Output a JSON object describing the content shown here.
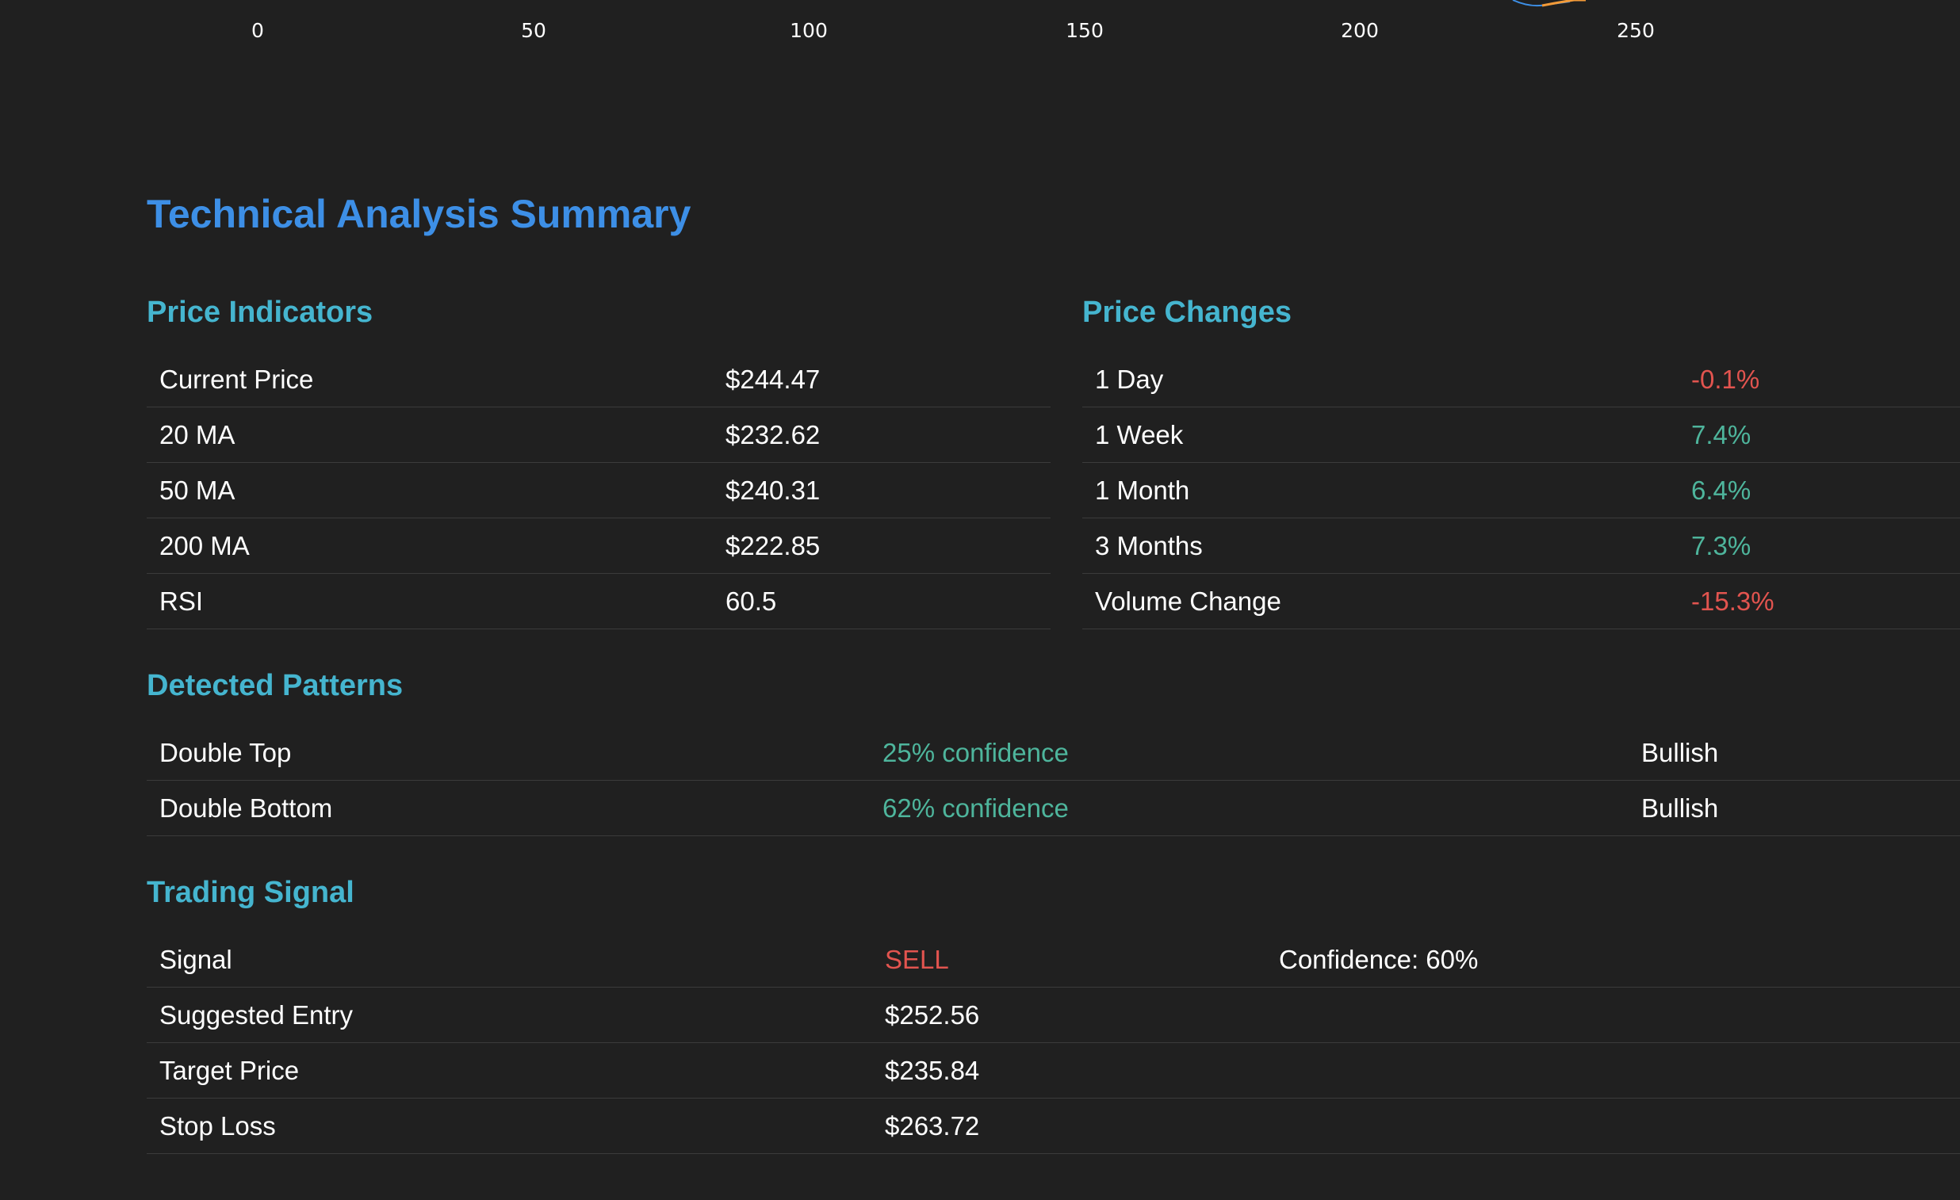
{
  "chart_data": {
    "type": "line",
    "x_ticks": [
      "0",
      "50",
      "100",
      "150",
      "200",
      "250"
    ],
    "series": [
      {
        "color": "#3d8fe6"
      },
      {
        "color": "#f29a38"
      }
    ]
  },
  "summary": {
    "title": "Technical Analysis Summary",
    "price_indicators": {
      "title": "Price Indicators",
      "rows": [
        {
          "label": "Current Price",
          "value": "$244.47"
        },
        {
          "label": "20 MA",
          "value": "$232.62"
        },
        {
          "label": "50 MA",
          "value": "$240.31"
        },
        {
          "label": "200 MA",
          "value": "$222.85"
        },
        {
          "label": "RSI",
          "value": "60.5"
        }
      ]
    },
    "price_changes": {
      "title": "Price Changes",
      "rows": [
        {
          "label": "1 Day",
          "value": "-0.1%",
          "tone": "negative"
        },
        {
          "label": "1 Week",
          "value": "7.4%",
          "tone": "positive"
        },
        {
          "label": "1 Month",
          "value": "6.4%",
          "tone": "positive"
        },
        {
          "label": "3 Months",
          "value": "7.3%",
          "tone": "positive"
        },
        {
          "label": "Volume Change",
          "value": "-15.3%",
          "tone": "negative"
        }
      ]
    },
    "patterns": {
      "title": "Detected Patterns",
      "rows": [
        {
          "name": "Double Top",
          "confidence": "25% confidence",
          "direction": "Bullish"
        },
        {
          "name": "Double Bottom",
          "confidence": "62% confidence",
          "direction": "Bullish"
        }
      ]
    },
    "trading_signal": {
      "title": "Trading Signal",
      "signal_label": "Signal",
      "signal_value": "SELL",
      "signal_confidence": "Confidence: 60%",
      "rows": [
        {
          "label": "Suggested Entry",
          "value": "$252.56"
        },
        {
          "label": "Target Price",
          "value": "$235.84"
        },
        {
          "label": "Stop Loss",
          "value": "$263.72"
        }
      ]
    }
  },
  "colors": {
    "background": "#202020",
    "title": "#3d8fe6",
    "section_title": "#45b5cf",
    "positive": "#4eb59c",
    "negative": "#e2544f"
  }
}
